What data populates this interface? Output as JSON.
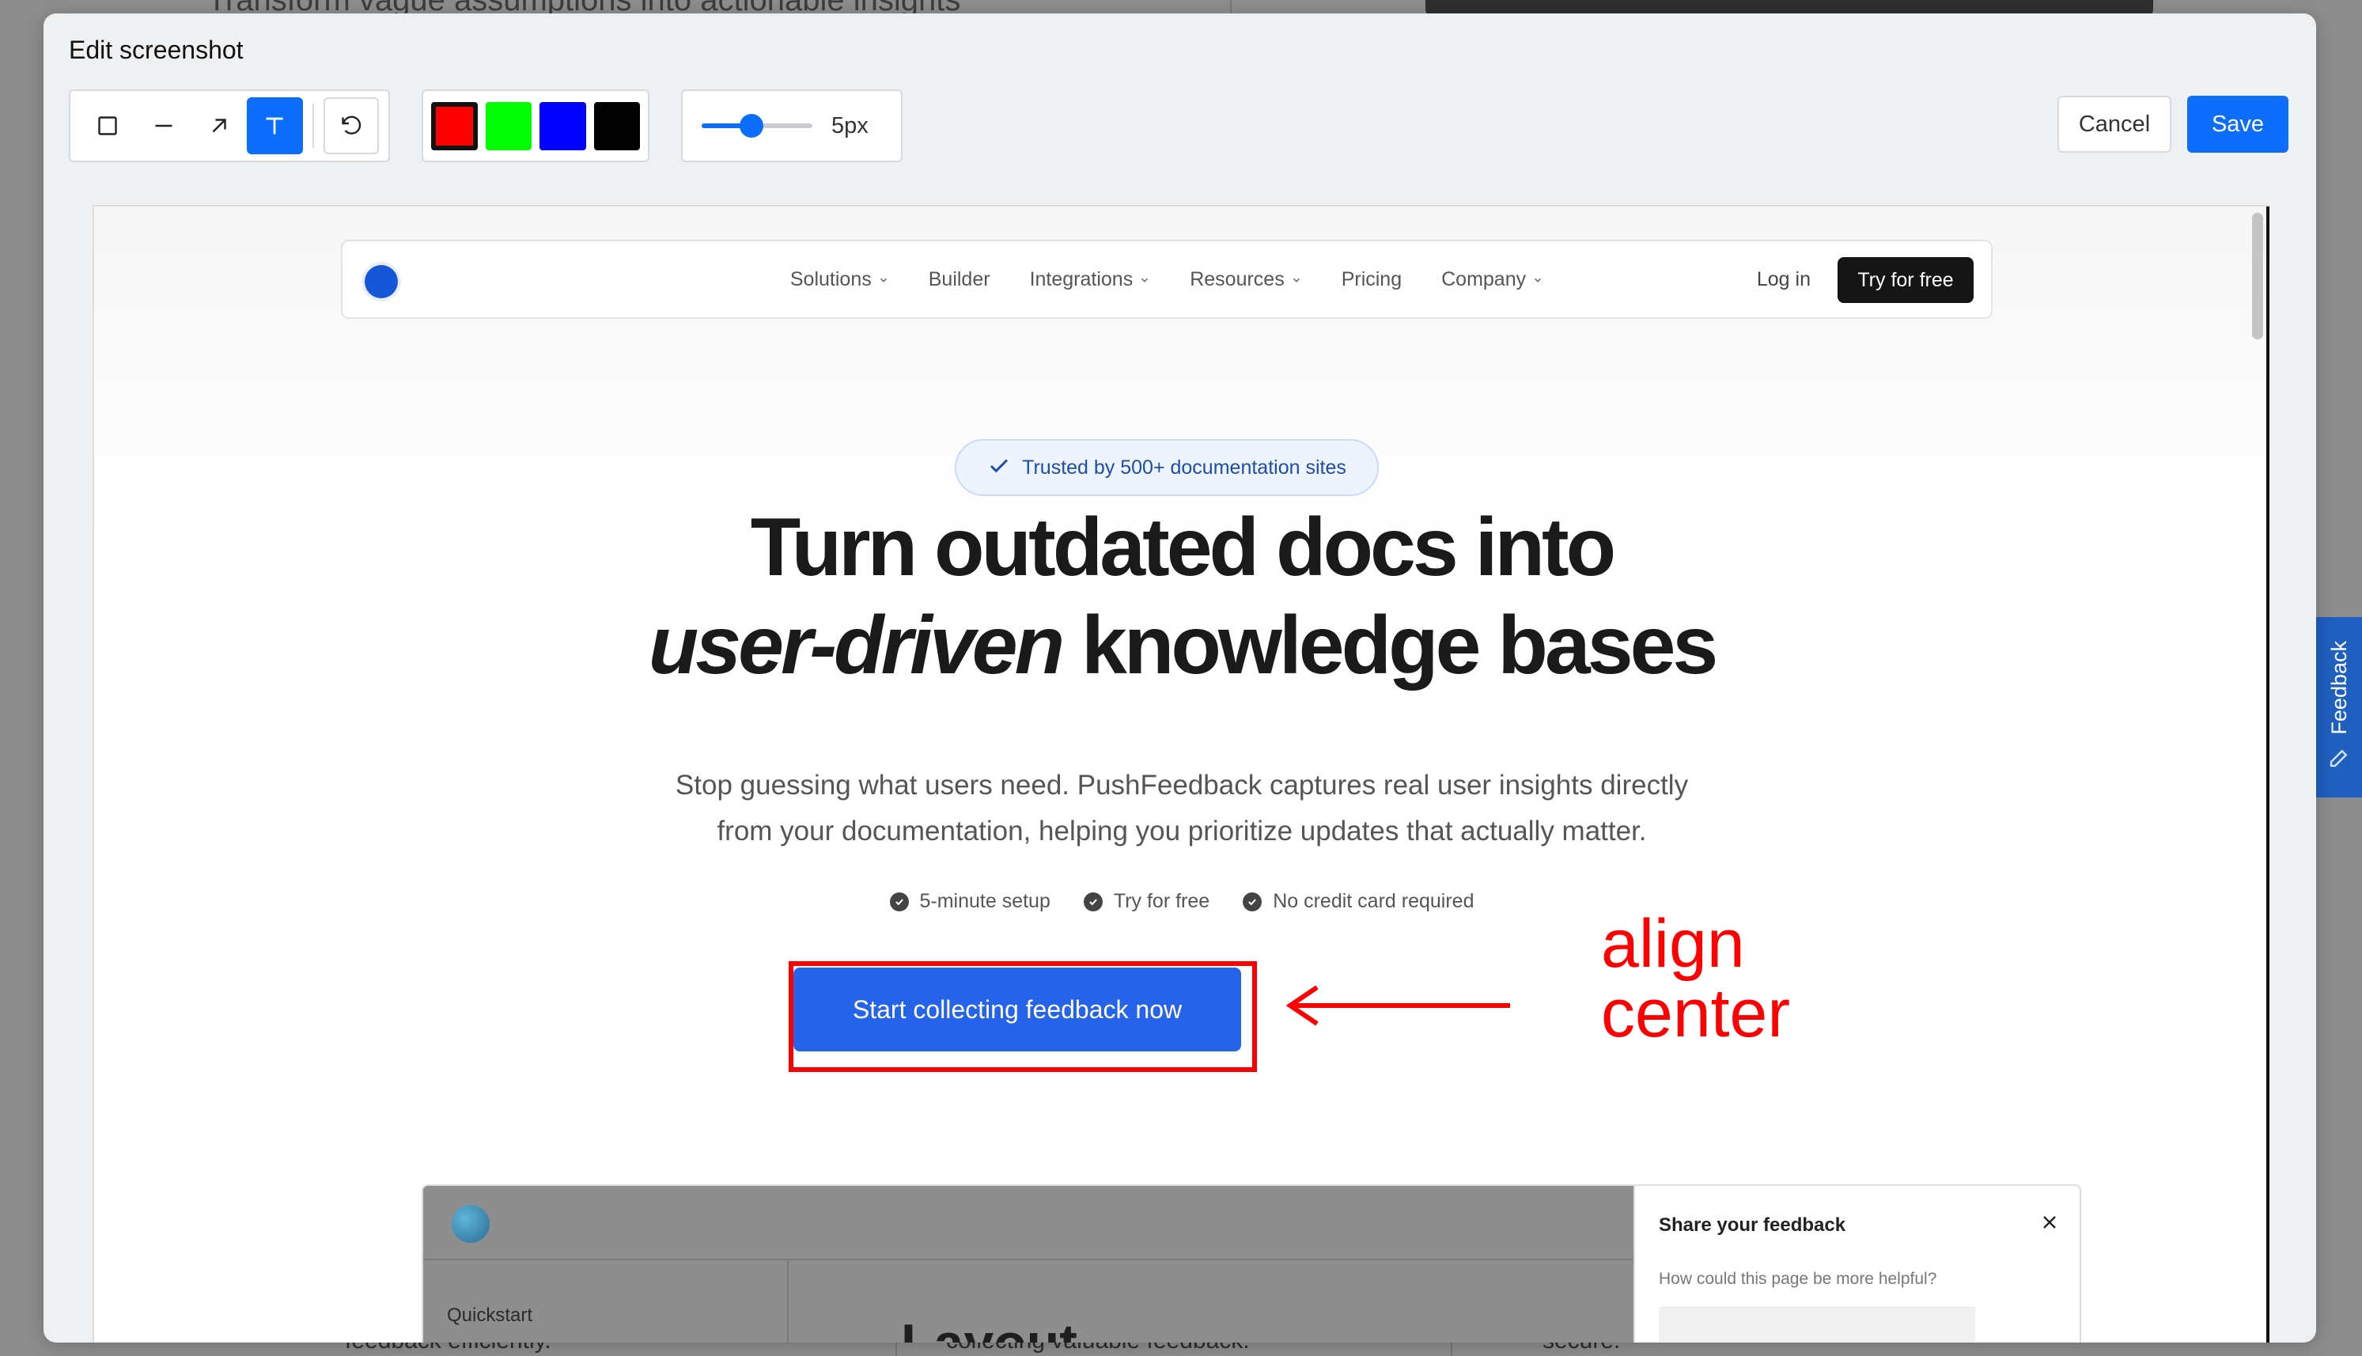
{
  "background": {
    "top_text": "Transform vague assumptions into actionable insights",
    "bottom_texts": [
      "feedback efficiently.",
      "collecting valuable feedback.",
      "secure."
    ]
  },
  "side_tab": {
    "label": "Feedback",
    "icon": "pencil-icon",
    "color": "#1f5fbf"
  },
  "modal": {
    "title": "Edit screenshot",
    "tools": [
      {
        "name": "rectangle-tool",
        "icon": "square-icon",
        "active": false
      },
      {
        "name": "line-tool",
        "icon": "line-icon",
        "active": false
      },
      {
        "name": "arrow-tool",
        "icon": "arrow-icon",
        "active": false
      },
      {
        "name": "text-tool",
        "icon": "text-icon",
        "active": true
      }
    ],
    "undo_icon": "undo-icon",
    "colors": [
      "#ff0000",
      "#00ff00",
      "#0000ff",
      "#000000"
    ],
    "selected_color": "#ff0000",
    "stroke": {
      "label": "5px",
      "value": 5,
      "slider_fraction": 0.45
    },
    "cancel_label": "Cancel",
    "save_label": "Save",
    "accent": "#0d6efd"
  },
  "screenshot": {
    "nav": {
      "links": [
        {
          "label": "Solutions",
          "dropdown": true
        },
        {
          "label": "Builder",
          "dropdown": false
        },
        {
          "label": "Integrations",
          "dropdown": true
        },
        {
          "label": "Resources",
          "dropdown": true
        },
        {
          "label": "Pricing",
          "dropdown": false
        },
        {
          "label": "Company",
          "dropdown": true
        }
      ],
      "login": "Log in",
      "cta": "Try for free"
    },
    "badge": "Trusted by 500+ documentation sites",
    "headline_line1": "Turn outdated docs into",
    "headline_line2_italic": "user-driven",
    "headline_line2_rest": " knowledge bases",
    "subtext_line1": "Stop guessing what users need. PushFeedback captures real user insights directly",
    "subtext_line2": "from your documentation, helping you prioritize updates that actually matter.",
    "checks": [
      "5-minute setup",
      "Try for free",
      "No credit card required"
    ],
    "cta_main": "Start collecting feedback now",
    "cta_color": "#2563eb",
    "preview": {
      "sidebar_item": "Quickstart",
      "title": "Layout",
      "feedback_title": "Share your feedback",
      "feedback_question": "How could this page be more helpful?"
    }
  },
  "annotations": {
    "text_line1": "align",
    "text_line2": "center",
    "color": "#ff0000"
  }
}
